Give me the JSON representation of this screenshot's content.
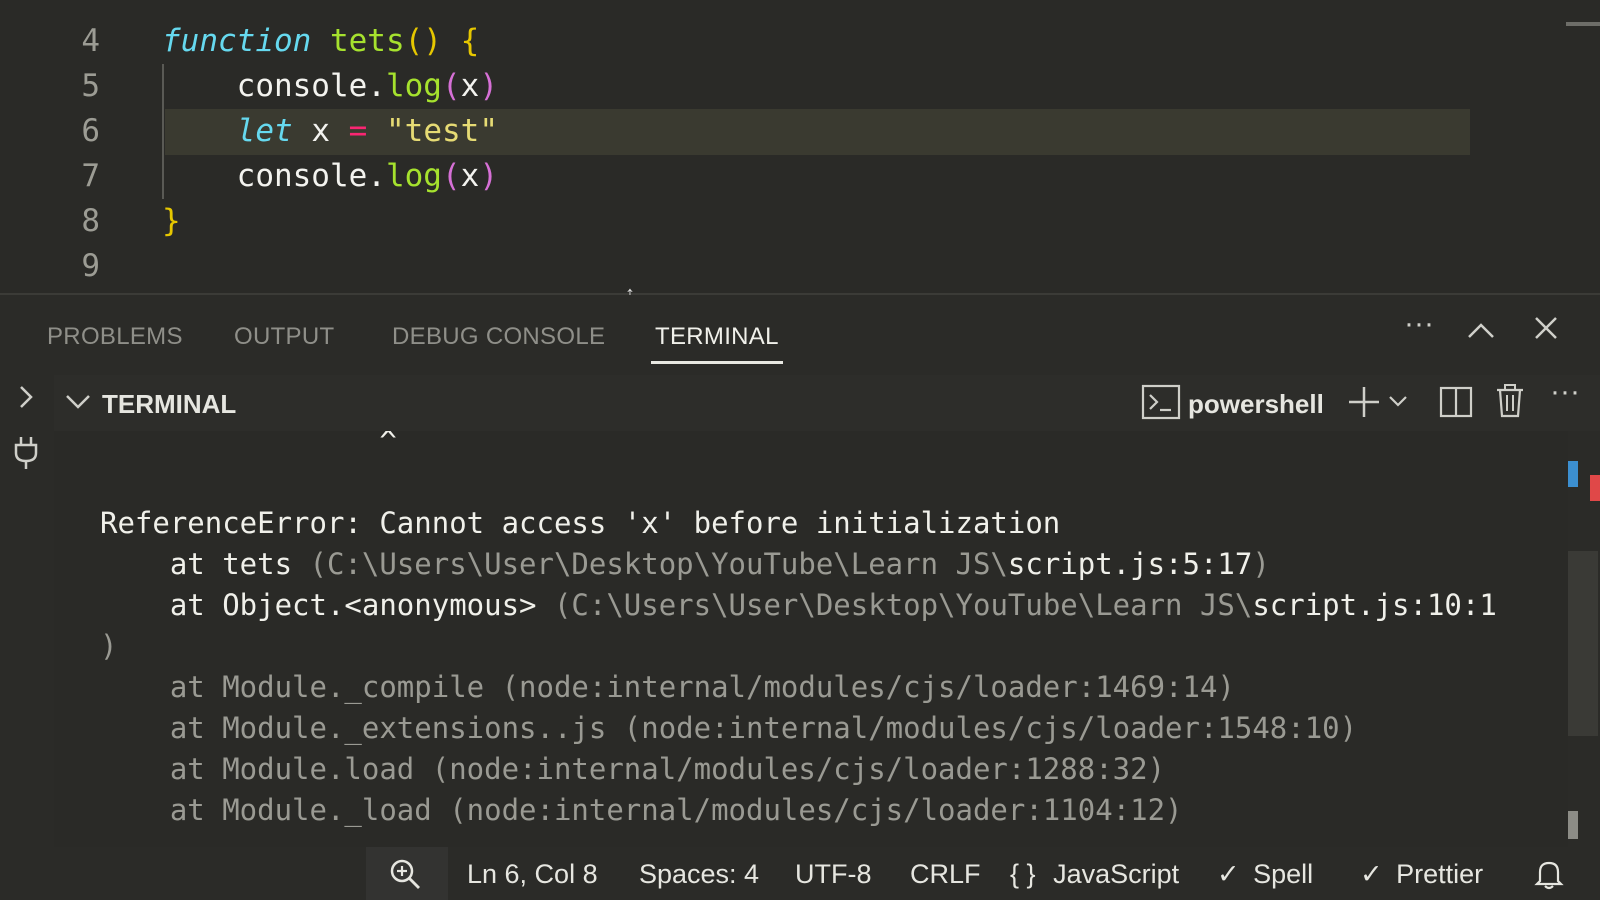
{
  "editor": {
    "lines": [
      {
        "num": "4",
        "tokens": [
          {
            "t": "function",
            "c": "kw"
          },
          {
            "t": " ",
            "c": "plain"
          },
          {
            "t": "tets",
            "c": "fn"
          },
          {
            "t": "()",
            "c": "paren"
          },
          {
            "t": " ",
            "c": "plain"
          },
          {
            "t": "{",
            "c": "paren"
          }
        ]
      },
      {
        "num": "5",
        "tokens": [
          {
            "t": "    console.",
            "c": "plain"
          },
          {
            "t": "log",
            "c": "fn"
          },
          {
            "t": "(",
            "c": "paren2"
          },
          {
            "t": "x",
            "c": "plain"
          },
          {
            "t": ")",
            "c": "paren2"
          }
        ]
      },
      {
        "num": "6",
        "tokens": [
          {
            "t": "    ",
            "c": "plain"
          },
          {
            "t": "let",
            "c": "kw"
          },
          {
            "t": " x ",
            "c": "plain"
          },
          {
            "t": "=",
            "c": "op"
          },
          {
            "t": " ",
            "c": "plain"
          },
          {
            "t": "\"test\"",
            "c": "str"
          }
        ]
      },
      {
        "num": "7",
        "tokens": [
          {
            "t": "    console.",
            "c": "plain"
          },
          {
            "t": "log",
            "c": "fn"
          },
          {
            "t": "(",
            "c": "paren2"
          },
          {
            "t": "x",
            "c": "plain"
          },
          {
            "t": ")",
            "c": "paren2"
          }
        ]
      },
      {
        "num": "8",
        "tokens": [
          {
            "t": "}",
            "c": "paren"
          }
        ]
      },
      {
        "num": "9",
        "tokens": []
      }
    ]
  },
  "panel": {
    "tabs": [
      "PROBLEMS",
      "OUTPUT",
      "DEBUG CONSOLE",
      "TERMINAL"
    ],
    "active_tab": "TERMINAL"
  },
  "terminal": {
    "section_title": "TERMINAL",
    "shell": "powershell",
    "lines": [
      {
        "segs": [
          {
            "t": "                ^",
            "c": "t-white"
          }
        ]
      },
      {
        "segs": []
      },
      {
        "segs": [
          {
            "t": "ReferenceError: Cannot access 'x' before initialization",
            "c": "t-white"
          }
        ]
      },
      {
        "segs": [
          {
            "t": "    at tets ",
            "c": "t-white"
          },
          {
            "t": "(C:\\Users\\User\\Desktop\\YouTube\\Learn JS\\",
            "c": "t-dim"
          },
          {
            "t": "script.js:5:17",
            "c": "t-white"
          },
          {
            "t": ")",
            "c": "t-dim"
          }
        ]
      },
      {
        "segs": [
          {
            "t": "    at Object.<anonymous> ",
            "c": "t-white"
          },
          {
            "t": "(C:\\Users\\User\\Desktop\\YouTube\\Learn JS\\",
            "c": "t-dim"
          },
          {
            "t": "script.js:10:1",
            "c": "t-white"
          }
        ]
      },
      {
        "segs": [
          {
            "t": ")",
            "c": "t-dim"
          }
        ]
      },
      {
        "segs": [
          {
            "t": "    at Module._compile (node:internal/modules/cjs/loader:1469:14)",
            "c": "t-dim"
          }
        ]
      },
      {
        "segs": [
          {
            "t": "    at Module._extensions..js (node:internal/modules/cjs/loader:1548:10)",
            "c": "t-dim"
          }
        ]
      },
      {
        "segs": [
          {
            "t": "    at Module.load (node:internal/modules/cjs/loader:1288:32)",
            "c": "t-dim"
          }
        ]
      },
      {
        "segs": [
          {
            "t": "    at Module._load (node:internal/modules/cjs/loader:1104:12)",
            "c": "t-dim"
          }
        ]
      }
    ]
  },
  "status": {
    "position": "Ln 6, Col 8",
    "spaces": "Spaces: 4",
    "encoding": "UTF-8",
    "eol": "CRLF",
    "language": "JavaScript",
    "language_icon": "{ }",
    "spell": "Spell",
    "prettier": "Prettier",
    "check_glyph": "✓"
  }
}
